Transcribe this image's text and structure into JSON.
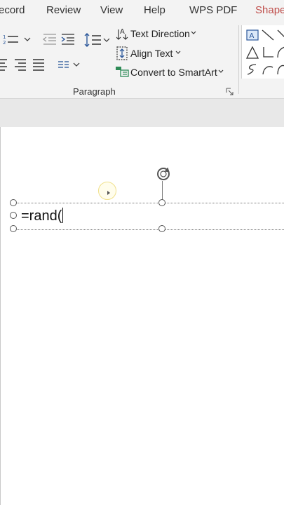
{
  "menu": {
    "items": [
      "ecord",
      "Review",
      "View",
      "Help",
      "WPS PDF",
      "Shape"
    ]
  },
  "ribbon": {
    "text_direction": "Text Direction",
    "align_text": "Align Text",
    "convert_smartart": "Convert to SmartArt",
    "group_label": "Paragraph"
  },
  "document": {
    "textbox_content": "=rand("
  },
  "colors": {
    "shape_tab": "#c0504d",
    "accent_blue": "#2b579a",
    "smartart_green": "#2e8b57"
  }
}
